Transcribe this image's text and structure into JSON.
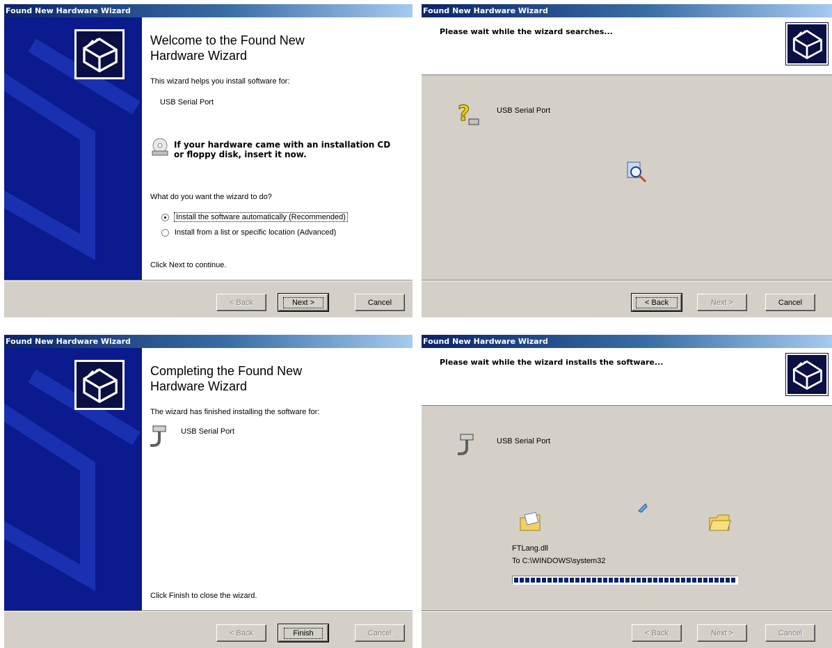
{
  "windows": {
    "welcome": {
      "title": "Found New Hardware Wizard",
      "heading": "Welcome to the Found New Hardware Wizard",
      "heading_line1": "Welcome to the Found New",
      "heading_line2": "Hardware Wizard",
      "intro": "This wizard helps you install software for:",
      "device": "USB Serial Port",
      "cd_note_line1": "If your hardware came with an installation CD",
      "cd_note_line2": "or floppy disk, insert it now.",
      "question": "What do you want the wizard to do?",
      "options": [
        {
          "label": "Install the software automatically (Recommended)",
          "selected": true
        },
        {
          "label": "Install from a list or specific location (Advanced)",
          "selected": false
        }
      ],
      "footer_text": "Click Next to continue.",
      "buttons": {
        "back": "< Back",
        "next": "Next >",
        "cancel": "Cancel"
      }
    },
    "searching": {
      "title": "Found New Hardware Wizard",
      "header_text": "Please wait while the wizard searches...",
      "device": "USB Serial Port",
      "buttons": {
        "back": "< Back",
        "next": "Next >",
        "cancel": "Cancel"
      }
    },
    "completing": {
      "title": "Found New Hardware Wizard",
      "heading_line1": "Completing the Found New",
      "heading_line2": "Hardware Wizard",
      "intro": "The wizard has finished installing the software for:",
      "device": "USB Serial Port",
      "footer_text": "Click Finish to close the wizard.",
      "buttons": {
        "back": "< Back",
        "finish": "Finish",
        "cancel": "Cancel"
      }
    },
    "installing": {
      "title": "Found New Hardware Wizard",
      "header_text": "Please wait while the wizard installs the software...",
      "device": "USB Serial Port",
      "file_name": "FTLang.dll",
      "destination": "To C:\\WINDOWS\\system32",
      "progress": 1.0,
      "buttons": {
        "back": "< Back",
        "next": "Next >",
        "cancel": "Cancel"
      }
    }
  },
  "icons": {
    "wizard_icon": "hardware-box-icon",
    "cd_icon": "cd-drive-icon",
    "unknown_device_icon": "question-device-icon",
    "search_icon": "magnifier-icon",
    "serial_icon": "serial-cable-icon",
    "folder_icon": "folder-icon",
    "paper_icon": "flying-paper-icon"
  },
  "colors": {
    "titlebar_start": "#0a246a",
    "titlebar_end": "#a6caf0",
    "sidebar": "#0b1a8c",
    "dialog_face": "#d4d0c8"
  }
}
